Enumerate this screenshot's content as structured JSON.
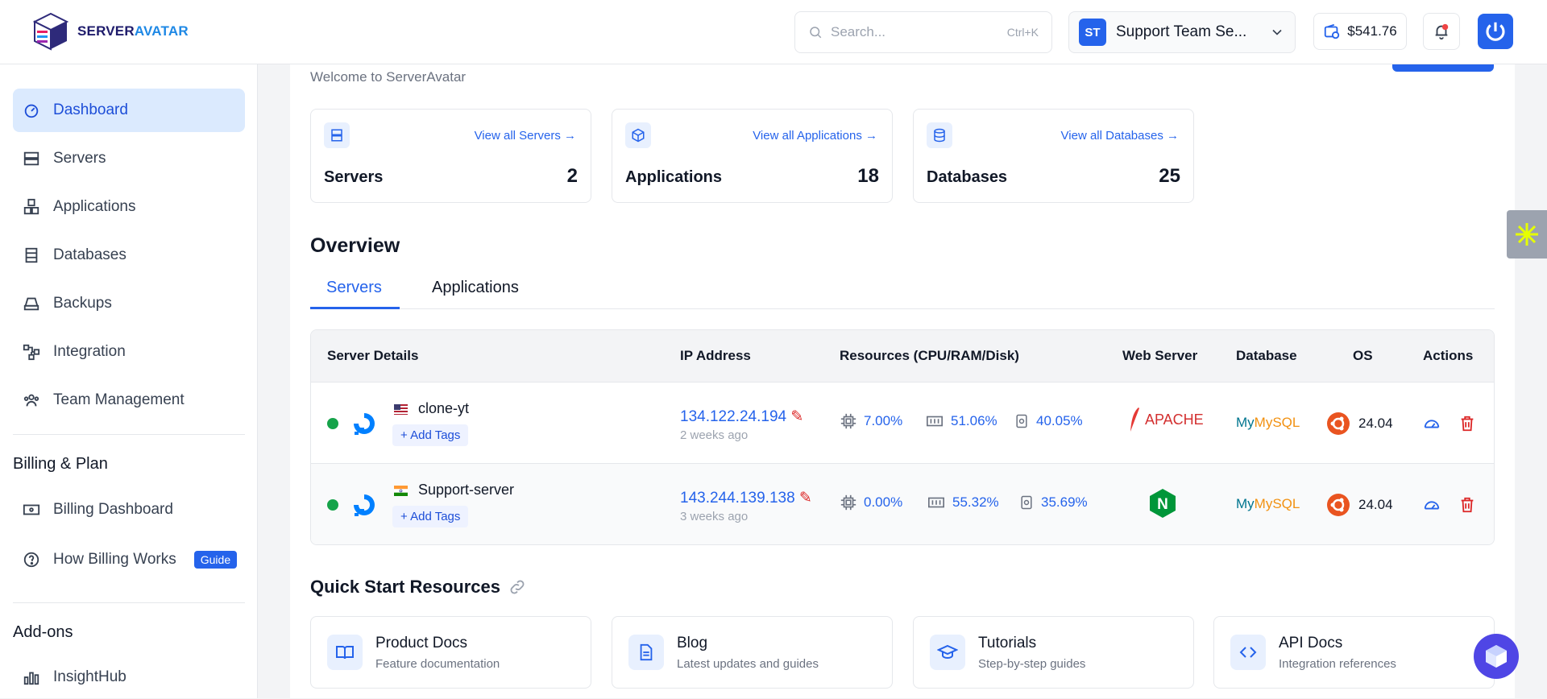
{
  "brand": {
    "name_part1": "SERVER",
    "name_part2": "AVATAR"
  },
  "header": {
    "search_placeholder": "Search...",
    "search_shortcut": "Ctrl+K",
    "team_initials": "ST",
    "team_name": "Support Team Se...",
    "balance": "$541.76"
  },
  "sidebar": {
    "items": [
      {
        "label": "Dashboard",
        "icon": "dashboard-icon"
      },
      {
        "label": "Servers",
        "icon": "servers-icon"
      },
      {
        "label": "Applications",
        "icon": "applications-icon"
      },
      {
        "label": "Databases",
        "icon": "databases-icon"
      },
      {
        "label": "Backups",
        "icon": "backups-icon"
      },
      {
        "label": "Integration",
        "icon": "integration-icon"
      },
      {
        "label": "Team Management",
        "icon": "team-icon"
      }
    ],
    "billing_title": "Billing & Plan",
    "billing_items": [
      {
        "label": "Billing Dashboard",
        "icon": "billing-icon"
      },
      {
        "label": "How Billing Works",
        "badge": "Guide",
        "icon": "help-icon"
      }
    ],
    "addons_title": "Add-ons",
    "addons_items": [
      {
        "label": "InsightHub",
        "icon": "chart-icon"
      }
    ]
  },
  "main": {
    "welcome": "Welcome to ServerAvatar",
    "stats": [
      {
        "label": "Servers",
        "value": "2",
        "link": "View all Servers"
      },
      {
        "label": "Applications",
        "value": "18",
        "link": "View all Applications"
      },
      {
        "label": "Databases",
        "value": "25",
        "link": "View all Databases"
      }
    ],
    "overview_title": "Overview",
    "tabs": [
      "Servers",
      "Applications"
    ],
    "table_headers": [
      "Server Details",
      "IP Address",
      "Resources (CPU/RAM/Disk)",
      "Web Server",
      "Database",
      "OS",
      "Actions"
    ],
    "add_tags": "Add Tags",
    "rows": [
      {
        "name": "clone-yt",
        "flag": "us",
        "ip": "134.122.24.194",
        "time": "2 weeks ago",
        "cpu": "7.00%",
        "ram": "51.06%",
        "disk": "40.05%",
        "web": "APACHE",
        "db": "MySQL",
        "os": "24.04"
      },
      {
        "name": "Support-server",
        "flag": "in",
        "ip": "143.244.139.138",
        "time": "3 weeks ago",
        "cpu": "0.00%",
        "ram": "55.32%",
        "disk": "35.69%",
        "web": "N",
        "db": "MySQL",
        "os": "24.04"
      }
    ],
    "quick_start_title": "Quick Start Resources",
    "quick_start": [
      {
        "title": "Product Docs",
        "subtitle": "Feature documentation"
      },
      {
        "title": "Blog",
        "subtitle": "Latest updates and guides"
      },
      {
        "title": "Tutorials",
        "subtitle": "Step-by-step guides"
      },
      {
        "title": "API Docs",
        "subtitle": "Integration references"
      }
    ]
  },
  "colors": {
    "accent": "#2563eb",
    "active_bg": "#dbeafe",
    "online": "#16a34a",
    "danger": "#dc2626"
  }
}
